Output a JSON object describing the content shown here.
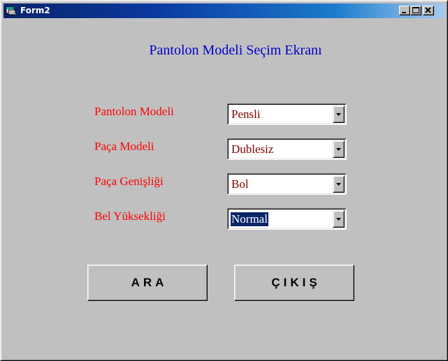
{
  "window": {
    "title": "Form2",
    "icon": "form-window-icon",
    "controls": {
      "minimize": "minimize-icon",
      "maximize": "maximize-icon",
      "close": "close-icon"
    }
  },
  "form": {
    "heading": "Pantolon Modeli Seçim Ekranı",
    "fields": [
      {
        "label": "Pantolon Modeli",
        "value": "Pensli",
        "selected": false
      },
      {
        "label": "Paça Modeli",
        "value": "Dublesiz",
        "selected": false
      },
      {
        "label": "Paça Genişliği",
        "value": "Bol",
        "selected": false
      },
      {
        "label": "Bel Yüksekliği",
        "value": "Normal",
        "selected": true
      }
    ],
    "buttons": {
      "search": "ARA",
      "exit": "ÇIKIŞ"
    }
  },
  "colors": {
    "heading": "#0000cc",
    "label": "#ff0000",
    "combo_text": "#800000",
    "selection_bg": "#0a246a",
    "titlebar_start": "#0a246a",
    "titlebar_end": "#a6caf0",
    "face": "#c0c0c0"
  }
}
